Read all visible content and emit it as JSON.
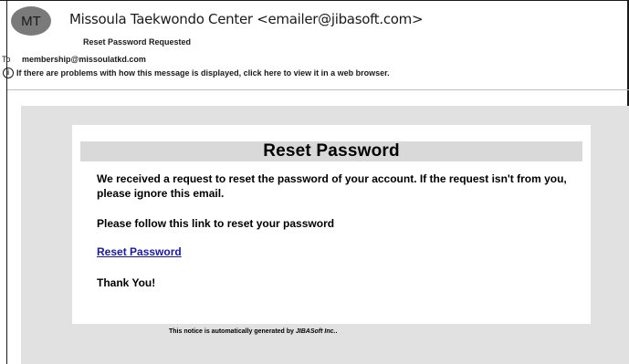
{
  "header": {
    "avatar_initials": "MT",
    "sender": "Missoula Taekwondo Center <emailer@jibasoft.com>",
    "subject": "Reset Password Requested",
    "to_label": "To",
    "to_address": "membership@missoulatkd.com",
    "info_icon": "info-icon",
    "info_text": "If there are problems with how this message is displayed, click here to view it in a web browser."
  },
  "email": {
    "title": "Reset Password",
    "paragraph_request": "We received a request to reset the password of your account. If the request isn't from you, please ignore this email.",
    "paragraph_follow": "Please follow this link to reset your password",
    "link_label": "Reset Password",
    "closing": "Thank You!",
    "footer_prefix": "This notice is automatically generated by ",
    "footer_brand": "JIBASoft Inc.",
    "footer_suffix": "."
  },
  "colors": {
    "avatar_bg": "#7a7a7a",
    "mail_bg": "#e1e1e1",
    "title_bar": "#d9d9d9",
    "link": "#1a1aa6"
  }
}
